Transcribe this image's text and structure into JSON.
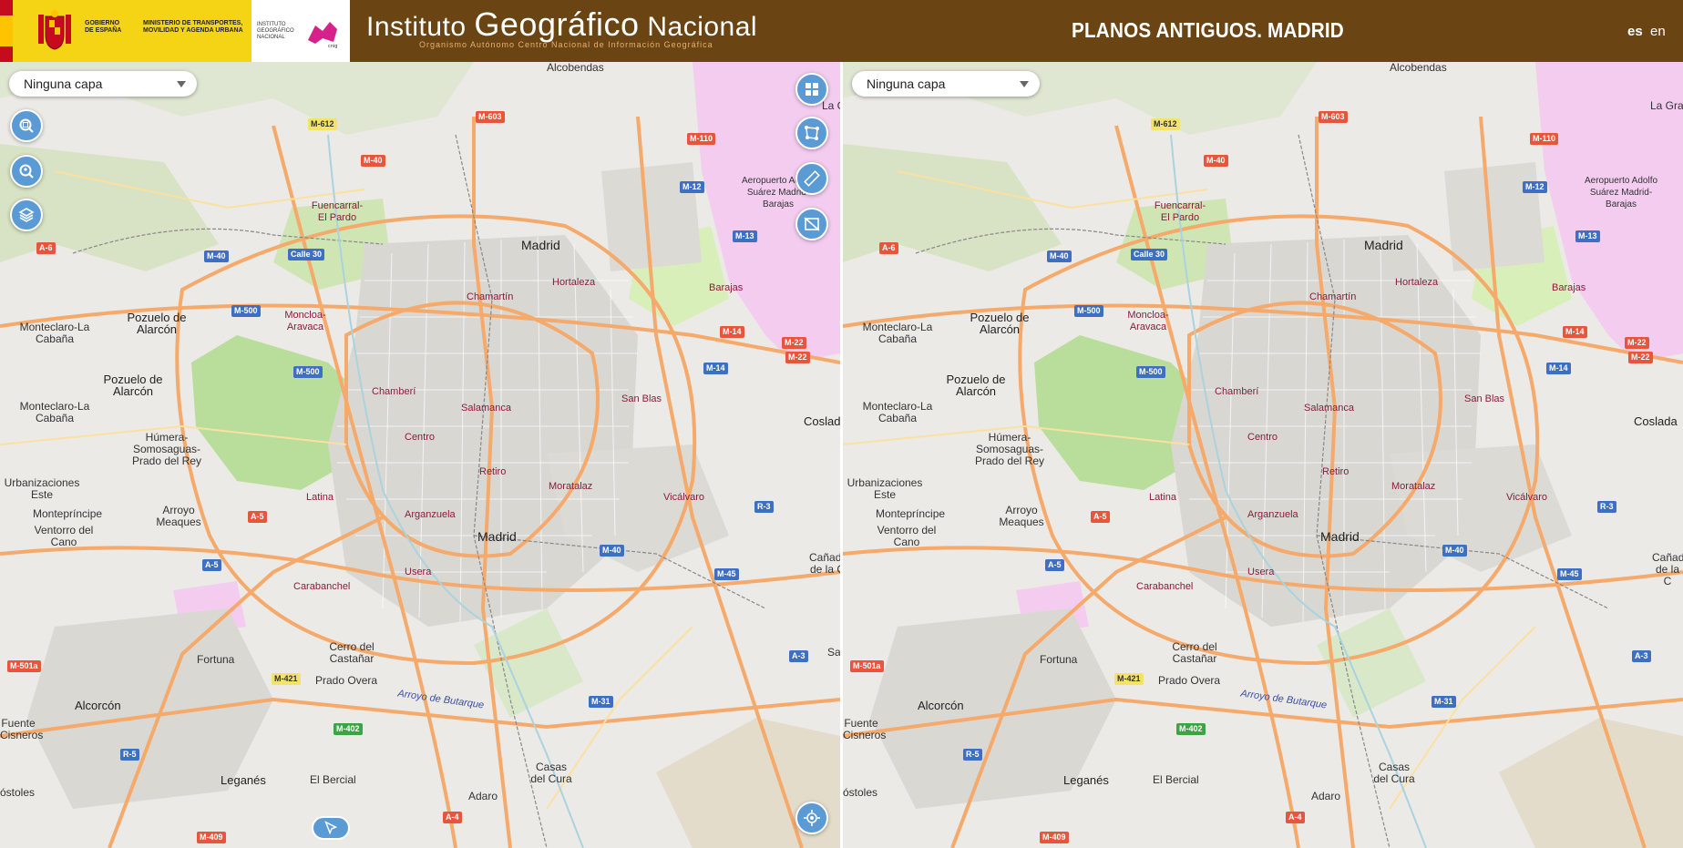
{
  "header": {
    "gov_text": "GOBIERNO DE ESPAÑA",
    "ministry_text": "MINISTERIO DE TRANSPORTES, MOVILIDAD Y AGENDA URBANA",
    "ign_small_text": "INSTITUTO GEOGRÁFICO NACIONAL",
    "institute_word1": "Instituto",
    "institute_word2": "Geográfico",
    "institute_word3": "Nacional",
    "institute_subtitle": "Organismo Autónomo   Centro Nacional de Información Geográfica",
    "page_title": "PLANOS ANTIGUOS. MADRID",
    "lang_es": "es",
    "lang_en": "en"
  },
  "left_map": {
    "layer_select": "Ninguna capa"
  },
  "right_map": {
    "layer_select": "Ninguna capa"
  },
  "icons": {
    "zoom": "zoom-area-icon",
    "search": "location-search-icon",
    "layers": "layers-icon",
    "grid": "grid-view-icon",
    "draw": "draw-polygon-icon",
    "ruler": "ruler-icon",
    "hide": "hide-layer-icon",
    "locate": "locate-icon",
    "pointer": "pointer-icon"
  },
  "map_labels": {
    "alcobendas": "Alcobendas",
    "la_gra": "La Gra",
    "m612": "M-612",
    "m603": "M-603",
    "m40a": "M-40",
    "m110": "M-110",
    "fuencarral": "Fuencarral-El Pardo",
    "aeropuerto": "Aeropuerto Adolfo Suárez Madrid-Barajas",
    "m12": "M-12",
    "a6": "A-6",
    "m40b": "M-40",
    "calle30": "Calle 30",
    "madrid_n": "Madrid",
    "m13": "M-13",
    "hortaleza": "Hortaleza",
    "chamartin": "Chamartín",
    "barajas": "Barajas",
    "m500a": "M-500",
    "monteclaro1": "Monteclaro-La Cabaña",
    "pozuelo1": "Pozuelo de Alarcón",
    "moncloa": "Moncloa-Aravaca",
    "m14a": "M-14",
    "m22a": "M-22",
    "m22b": "M-22",
    "m500b": "M-500",
    "m14b": "M-14",
    "pozuelo2": "Pozuelo de Alarcón",
    "chamberi": "Chamberí",
    "sanblas": "San Blas",
    "monteclaro2": "Monteclaro-La Cabaña",
    "salamanca": "Salamanca",
    "coslada": "Coslada",
    "humera": "Húmera-Somosaguas-Prado del Rey",
    "centro": "Centro",
    "retiro": "Retiro",
    "urbanizaciones": "Urbanizaciones Este",
    "moratalaz": "Moratalaz",
    "latina": "Latina",
    "vicalvaro": "Vicálvaro",
    "r3": "R-3",
    "arroyo": "Arroyo Meaques",
    "monteprincipe": "Montepríncipe",
    "a5a": "A-5",
    "arganzuela": "Arganzuela",
    "ventorro": "Ventorro del Cano",
    "madrid_c": "Madrid",
    "m40c": "M-40",
    "canada": "Cañada de la C",
    "a5b": "A-5",
    "usera": "Usera",
    "m45": "M-45",
    "carabanchel": "Carabanchel",
    "m501a": "M-501a",
    "fortuna": "Fortuna",
    "cerro": "Cerro del Castañar",
    "a3": "A-3",
    "sa": "Sa",
    "m421": "M-421",
    "pradoovera": "Prado Overa",
    "arroyo_butarque": "Arroyo de Butarque",
    "alcorcon": "Alcorcón",
    "m31": "M-31",
    "fuente": "Fuente Cisneros",
    "m402": "M-402",
    "r5": "R-5",
    "casas": "Casas del Cura",
    "leganes": "Leganés",
    "elbercial": "El Bercial",
    "ostoles": "óstoles",
    "adaro": "Adaro",
    "a4": "A-4",
    "m409": "M-409"
  },
  "colors": {
    "header_bg": "#6b4413",
    "control_blue": "#5b9bd5",
    "park_green": "#b9dd9a",
    "road_orange": "#f5a96a",
    "airport_pink": "#f3ccf0"
  }
}
